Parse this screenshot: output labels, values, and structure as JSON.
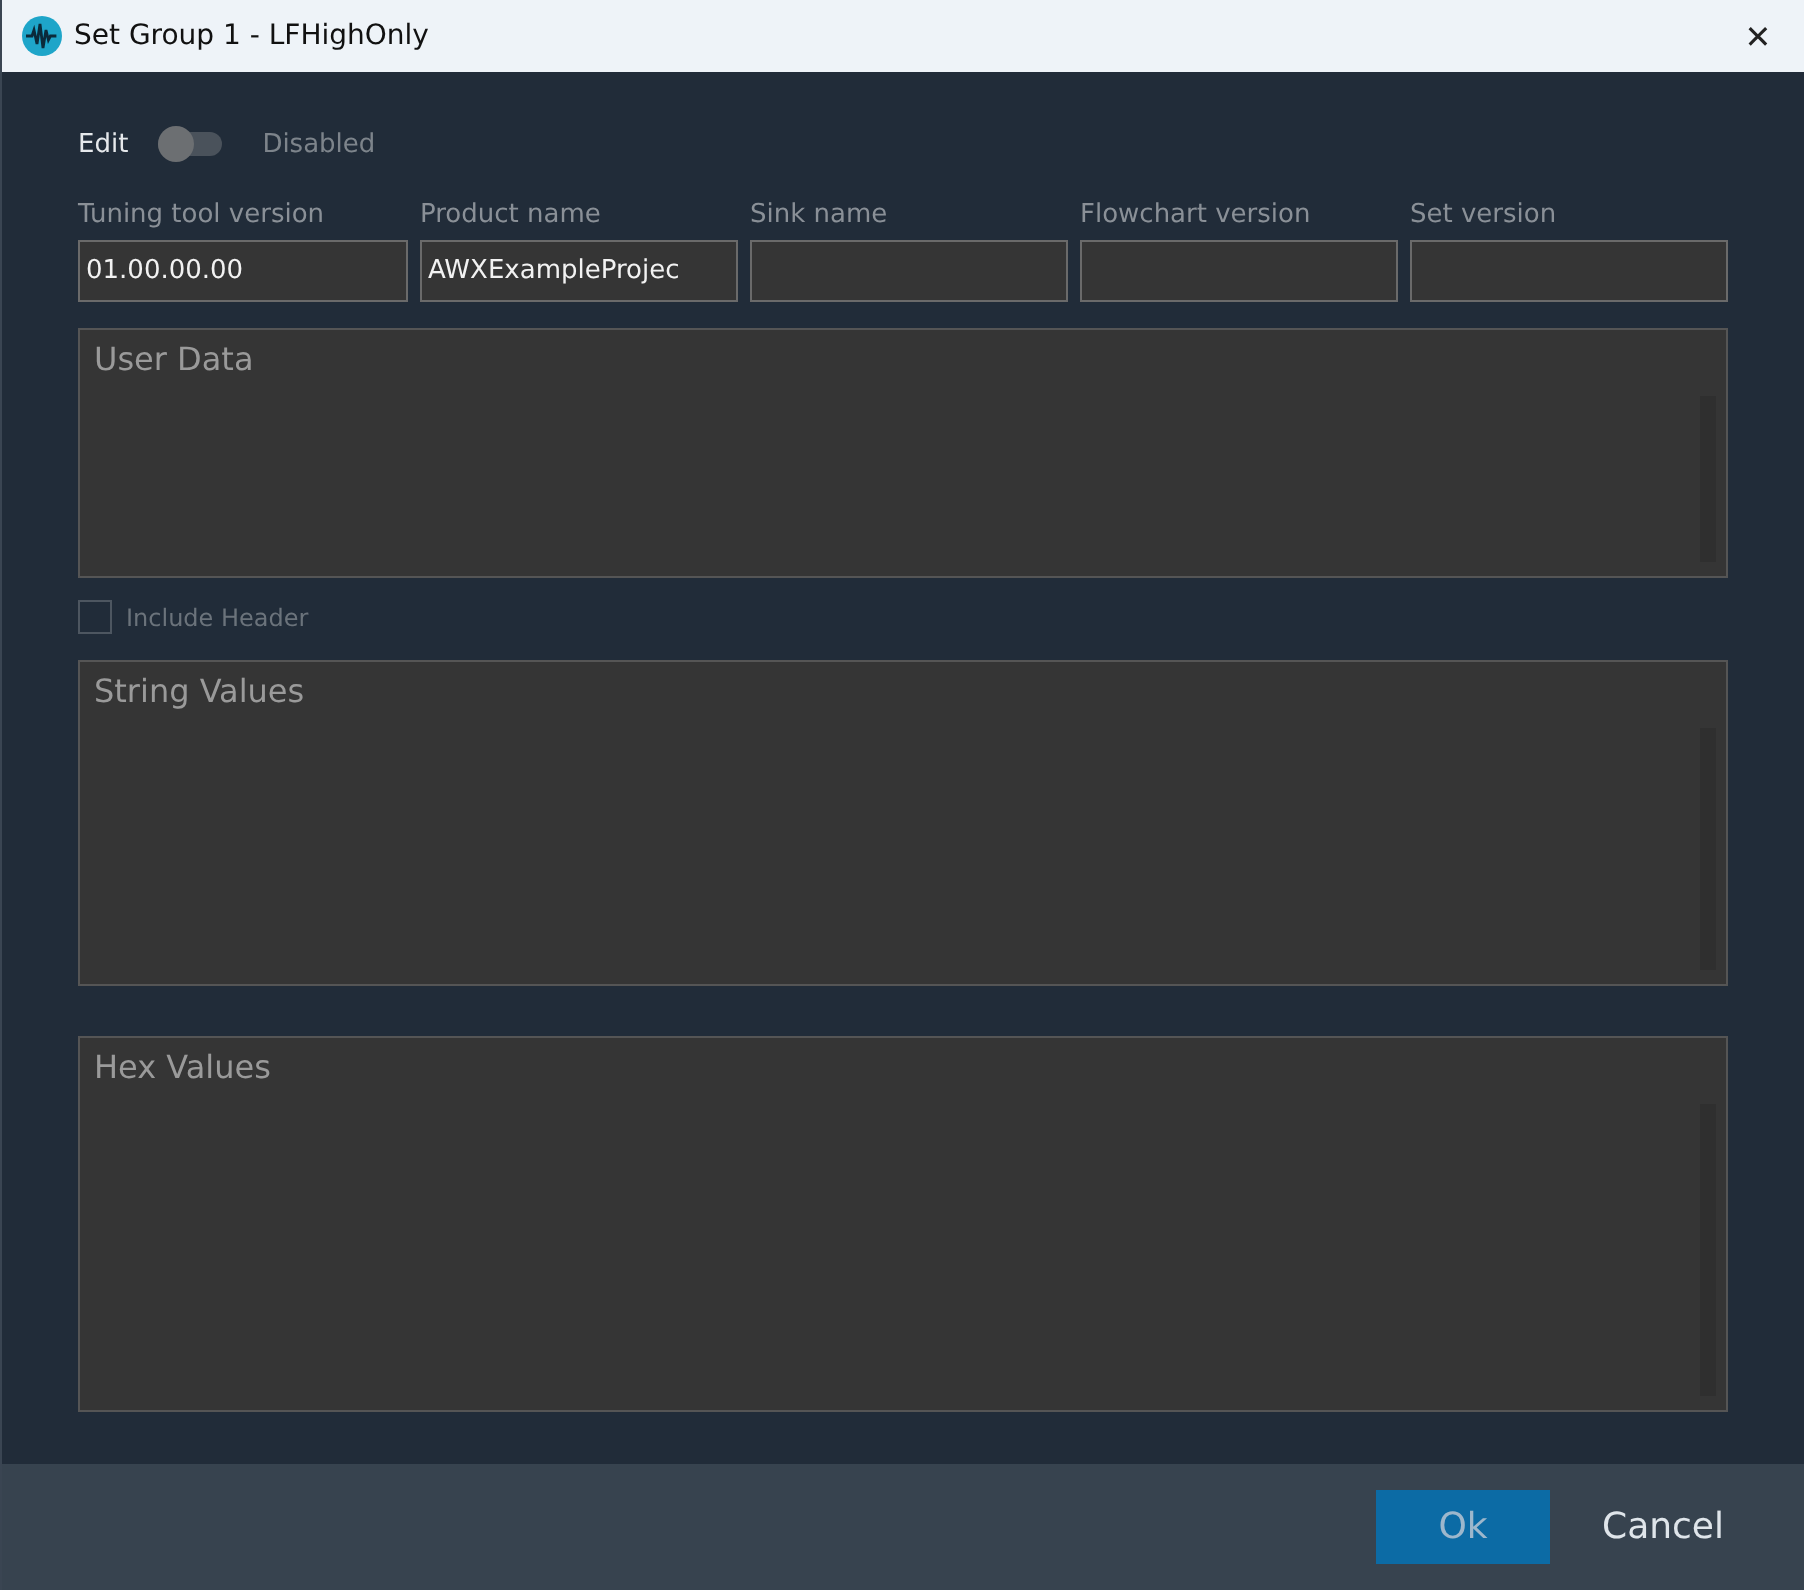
{
  "window": {
    "title": "Set Group 1 - LFHighOnly",
    "close": "✕"
  },
  "edit": {
    "label": "Edit",
    "on": false,
    "state_text": "Disabled"
  },
  "fields": [
    {
      "label": "Tuning tool version",
      "value": "01.00.00.00"
    },
    {
      "label": "Product name",
      "value": "AWXExampleProjec"
    },
    {
      "label": "Sink name"
    },
    {
      "label": "Flowchart version"
    },
    {
      "label": "Set version"
    }
  ],
  "user_data": {
    "placeholder": "User Data"
  },
  "include_header": {
    "label": "Include Header",
    "checked": false,
    "disabled": true
  },
  "string_values": {
    "placeholder": "String Values"
  },
  "hex_values": {
    "placeholder": "Hex Values"
  },
  "buttons": [
    {
      "label": "Ok",
      "kind": "primary",
      "disabled": true
    },
    {
      "label": "Cancel",
      "kind": "plain",
      "disabled": false
    }
  ]
}
